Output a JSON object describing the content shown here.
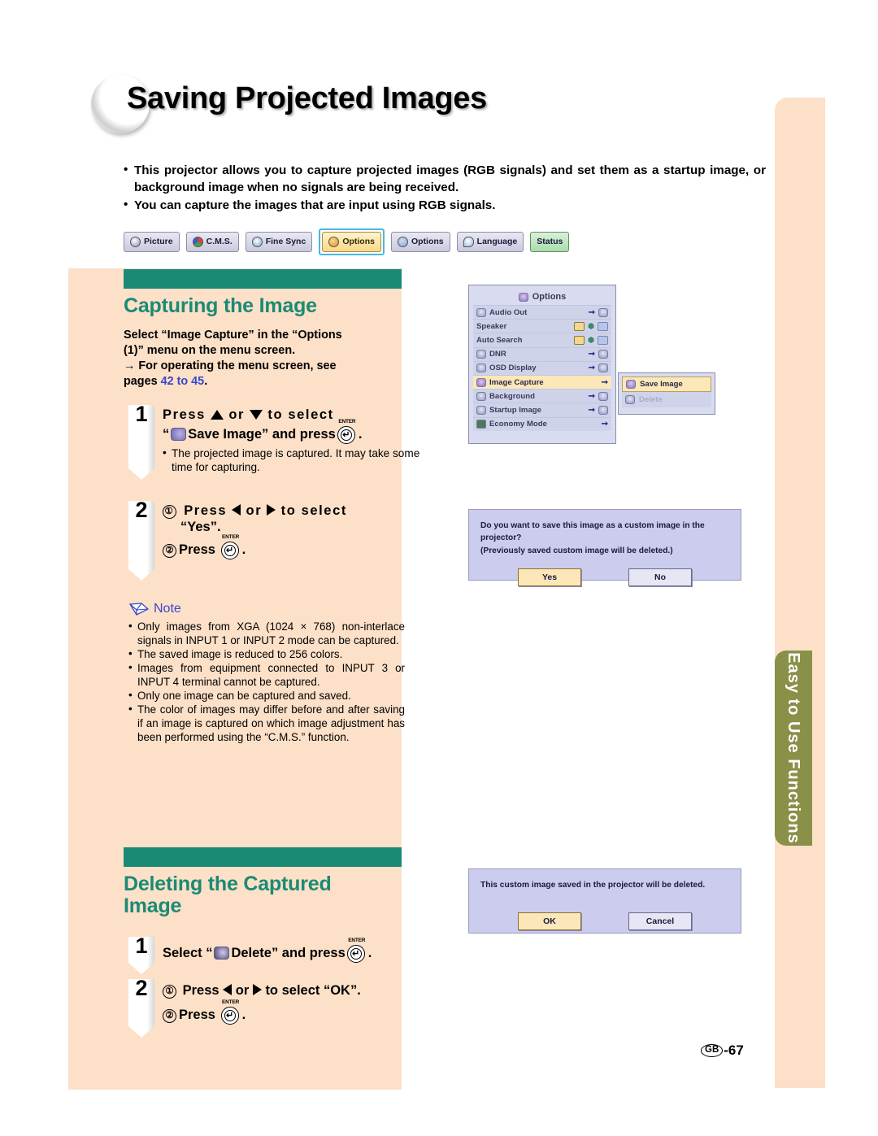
{
  "page": {
    "title": "Saving Projected Images",
    "number_mark": "GB",
    "number": "-67",
    "side_tab": "Easy to Use Functions"
  },
  "intro": {
    "bullet1": "This projector allows you to capture projected images (RGB signals) and set them as a startup image, or background image when no signals are being received.",
    "bullet2": "You can capture the images that are input using RGB signals."
  },
  "menu_tabs": [
    {
      "label": "Picture",
      "icon": "picture-icon",
      "selected": false
    },
    {
      "label": "C.M.S.",
      "icon": "cms-icon",
      "selected": false
    },
    {
      "label": "Fine Sync",
      "icon": "fine-sync-icon",
      "selected": false
    },
    {
      "label": "Options",
      "icon": "options1-icon",
      "selected": true
    },
    {
      "label": "Options",
      "icon": "options2-icon",
      "selected": false
    },
    {
      "label": "Language",
      "icon": "language-icon",
      "selected": false
    },
    {
      "label": "Status",
      "icon": "status-icon",
      "selected": false
    }
  ],
  "section1": {
    "heading": "Capturing the Image",
    "lead_line1": "Select “Image Capture” in the “Options",
    "lead_line2": "(1)” menu on the menu screen.",
    "lead_line3": "→ For operating the menu screen, see",
    "lead_line4_pre": "pages ",
    "lead_line4_link": "42 to 45",
    "lead_line4_post": ".",
    "step1": {
      "num": "1",
      "line1_a": "Press",
      "line1_b": "or",
      "line1_c": "to select",
      "line2_a": "“",
      "line2_b": "Save Image” and press",
      "line2_c": ".",
      "enter_label": "ENTER",
      "note": "The projected image is captured. It may take some time for capturing."
    },
    "step2": {
      "num": "2",
      "c1": "①",
      "l1_a": "Press",
      "l1_b": "or",
      "l1_c": "to select",
      "l2": "“Yes”.",
      "c2": "②",
      "l3_a": "Press",
      "l3_b": ".",
      "enter_label": "ENTER"
    }
  },
  "note": {
    "heading": "Note",
    "items": [
      "Only images from XGA (1024 × 768) non-interlace signals in INPUT 1 or INPUT 2 mode can be captured.",
      "The saved image is reduced to 256 colors.",
      "Images from equipment connected to INPUT 3 or INPUT 4 terminal cannot be captured.",
      "Only one image can be captured and saved.",
      "The color of images may differ before and after saving if an image is captured on which image adjustment has been performed using the “C.M.S.” function."
    ]
  },
  "section2": {
    "heading_line1": "Deleting the Captured",
    "heading_line2": "Image",
    "step1": {
      "num": "1",
      "a": "Select “",
      "b": "Delete” and press",
      "c": ".",
      "enter_label": "ENTER"
    },
    "step2": {
      "num": "2",
      "c1": "①",
      "l1_a": "Press",
      "l1_b": "or",
      "l1_c": "to select “OK”.",
      "c2": "②",
      "l2_a": "Press",
      "l2_b": ".",
      "enter_label": "ENTER"
    }
  },
  "osd": {
    "title": "Options",
    "rows": [
      {
        "label": "Audio Out",
        "icon": "speaker-icon",
        "control": "arrow"
      },
      {
        "label": "Speaker",
        "icon": "",
        "control": "toggle"
      },
      {
        "label": "Auto Search",
        "icon": "",
        "control": "toggle"
      },
      {
        "label": "DNR",
        "icon": "dnr-icon",
        "control": "arrow"
      },
      {
        "label": "OSD Display",
        "icon": "osd-display-icon",
        "control": "arrow"
      },
      {
        "label": "Image Capture",
        "icon": "capture-icon",
        "control": "arrow",
        "highlighted": true
      },
      {
        "label": "Background",
        "icon": "background-icon",
        "control": "arrow"
      },
      {
        "label": "Startup Image",
        "icon": "startup-icon",
        "control": "arrow"
      },
      {
        "label": "Economy Mode",
        "icon": "economy-icon",
        "control": "arrow"
      }
    ],
    "submenu": [
      {
        "label": "Save Image",
        "icon": "save-image-icon",
        "highlighted": true,
        "disabled": false
      },
      {
        "label": "Delete",
        "icon": "delete-icon",
        "highlighted": false,
        "disabled": true
      }
    ]
  },
  "dialog_save": {
    "line1": "Do you want to save this image as a custom image in the projector?",
    "line2": "(Previously saved custom image will be deleted.)",
    "btn_yes": "Yes",
    "btn_no": "No"
  },
  "dialog_delete": {
    "line1": "This custom image saved in the projector will be deleted.",
    "btn_ok": "OK",
    "btn_cancel": "Cancel"
  }
}
